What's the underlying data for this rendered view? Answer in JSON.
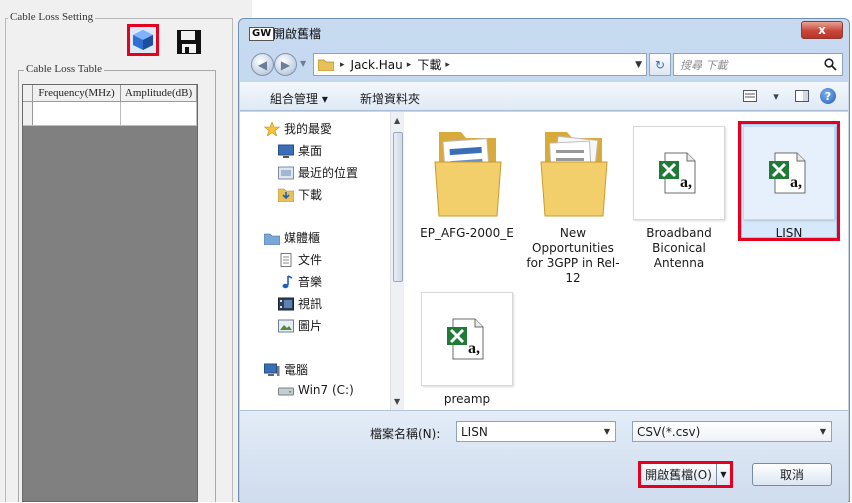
{
  "left_app": {
    "group_label": "Cable Loss Setting",
    "table_group_label": "Cable Loss Table",
    "columns": [
      "Frequency(MHz)",
      "Amplitude(dB)"
    ]
  },
  "dialog": {
    "app_icon_text": "GW",
    "title": "開啟舊檔",
    "close_label": "x",
    "breadcrumbs": [
      "Jack.Hau",
      "下載"
    ],
    "search_placeholder": "搜尋 下載",
    "toolbar": {
      "organize": "組合管理 ▾",
      "new_folder": "新增資料夾"
    },
    "nav": {
      "favorites": "我的最愛",
      "desktop": "桌面",
      "recent": "最近的位置",
      "downloads": "下載",
      "libraries": "媒體櫃",
      "documents": "文件",
      "music": "音樂",
      "videos": "視訊",
      "pictures": "圖片",
      "computer": "電腦",
      "drive": "Win7 (C:)"
    },
    "files": [
      {
        "name": "EP_AFG-2000_E",
        "type": "folder"
      },
      {
        "name": "New Opportunities for 3GPP in Rel-12",
        "type": "folder"
      },
      {
        "name": "Broadband Biconical Antenna",
        "type": "csv"
      },
      {
        "name": "LISN",
        "type": "csv",
        "selected": true
      },
      {
        "name": "preamp",
        "type": "csv"
      }
    ],
    "icon_letter": "a,",
    "filename_label": "檔案名稱(N):",
    "filename_value": "LISN",
    "filetype_value": "CSV(*.csv)",
    "open_button": "開啟舊檔(O)",
    "cancel_button": "取消"
  },
  "colors": {
    "highlight": "#e5001f",
    "selection": "#d6e8fb",
    "excel_green": "#1f7a35"
  }
}
